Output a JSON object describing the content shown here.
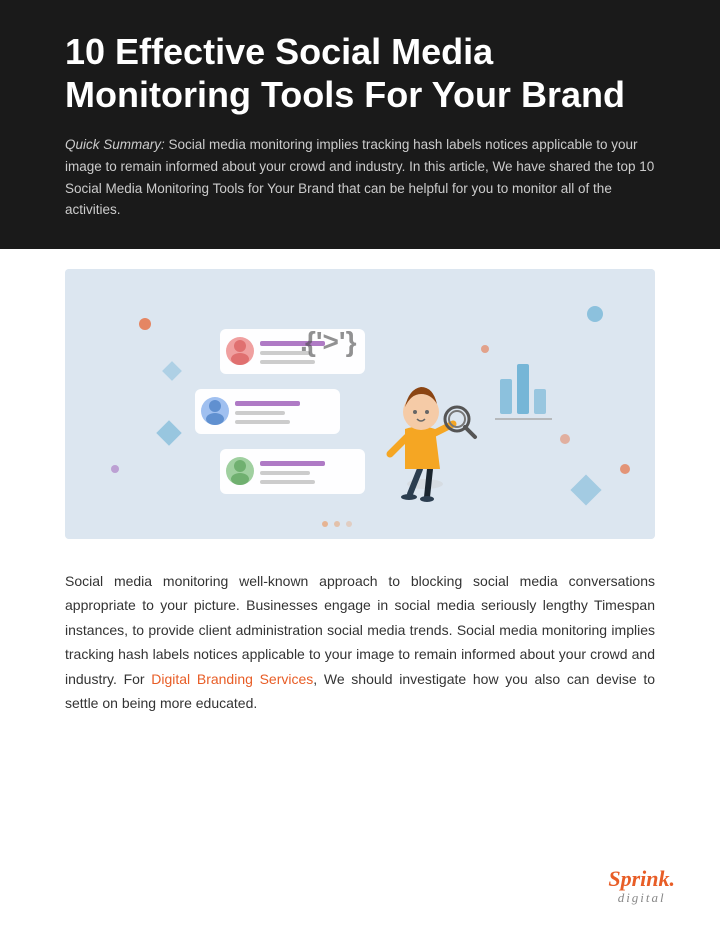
{
  "header": {
    "title": "10 Effective Social Media Monitoring Tools For Your Brand",
    "quick_summary_label": "Quick Summary:",
    "quick_summary_text": " Social media monitoring implies tracking hash labels notices applicable to your image to remain informed about your crowd and industry. In this article, We have shared the top 10 Social Media Monitoring Tools for Your Brand that can be helpful for you to monitor all of the activities."
  },
  "body": {
    "paragraph": "Social media monitoring well-known approach to blocking social media conversations appropriate to your picture. Businesses engage in social media seriously lengthy Timespan instances, to provide client administration social media trends. Social media monitoring implies tracking hash labels notices applicable to your image to remain informed about your crowd and industry. For ",
    "link_text": "Digital Branding Services",
    "paragraph_end": ", We should investigate how you also can devise to settle on being more educated."
  },
  "footer": {
    "logo_sprink": "Sprink",
    "logo_digital": "digital"
  },
  "colors": {
    "header_bg": "#1a1a1a",
    "header_text": "#ffffff",
    "summary_text": "#cccccc",
    "body_text": "#333333",
    "link_color": "#e85d26",
    "logo_color": "#e85d26",
    "image_bg": "#dce6f0"
  }
}
